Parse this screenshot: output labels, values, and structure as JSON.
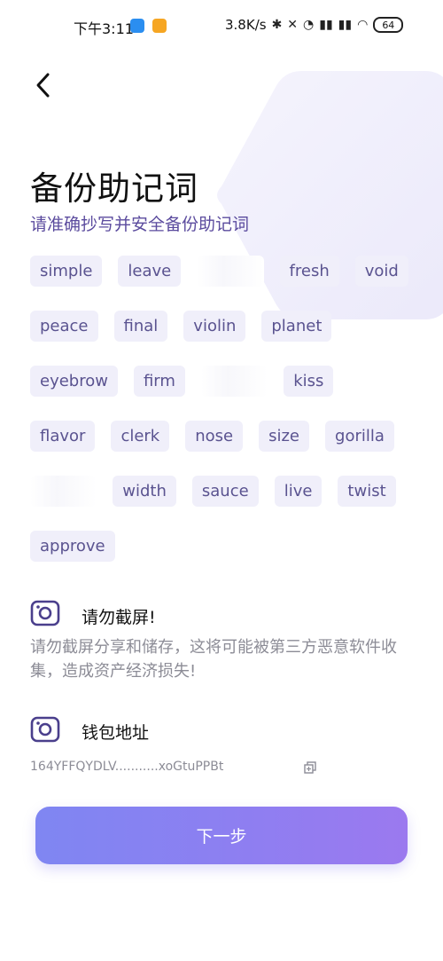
{
  "status_bar": {
    "time": "下午3:11",
    "net_speed": "3.8K/s",
    "battery": "64"
  },
  "page": {
    "title": "备份助记词",
    "subtitle": "请准确抄写并安全备份助记词"
  },
  "mnemonic": {
    "rows": [
      [
        {
          "text": "simple"
        },
        {
          "text": "leave"
        },
        {
          "text": "",
          "blurred": true
        },
        {
          "text": "fresh"
        },
        {
          "text": "void"
        }
      ],
      [
        {
          "text": "peace"
        },
        {
          "text": "final"
        },
        {
          "text": "violin"
        },
        {
          "text": "planet"
        }
      ],
      [
        {
          "text": "eyebrow"
        },
        {
          "text": "firm"
        },
        {
          "text": "",
          "blurred": true
        },
        {
          "text": "kiss"
        }
      ],
      [
        {
          "text": "flavor"
        },
        {
          "text": "clerk"
        },
        {
          "text": "nose"
        },
        {
          "text": "size"
        },
        {
          "text": "gorilla"
        }
      ],
      [
        {
          "text": "",
          "blurred": true
        },
        {
          "text": "width"
        },
        {
          "text": "sauce"
        },
        {
          "text": "live"
        },
        {
          "text": "twist"
        }
      ],
      [
        {
          "text": "approve"
        }
      ]
    ]
  },
  "warning": {
    "title": "请勿截屏!",
    "text": "请勿截屏分享和储存，这将可能被第三方恶意软件收集，造成资产经济损失!"
  },
  "wallet": {
    "title": "钱包地址",
    "address": "164YFFQYDLV...........xoGtuPPBt"
  },
  "buttons": {
    "next": "下一步"
  },
  "colors": {
    "accent": "#5b4b9e",
    "chip_bg": "#f0effa",
    "button_start": "#7f86f2",
    "button_end": "#9b79ef"
  },
  "icons": [
    "back-arrow-icon",
    "camera-icon",
    "copy-icon",
    "bluetooth-icon",
    "alarm-icon",
    "signal-icon",
    "wifi-icon",
    "battery-icon"
  ]
}
